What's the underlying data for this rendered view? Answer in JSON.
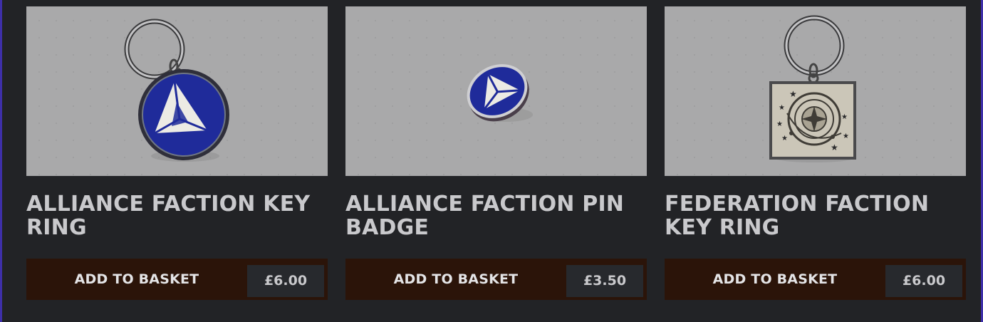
{
  "products": [
    {
      "title": "ALLIANCE FACTION KEY RING",
      "button_label": "ADD TO BASKET",
      "price": "£6.00",
      "image": "alliance-key-ring-photo"
    },
    {
      "title": "ALLIANCE FACTION PIN BADGE",
      "button_label": "ADD TO BASKET",
      "price": "£3.50",
      "image": "alliance-pin-badge-photo"
    },
    {
      "title": "FEDERATION FACTION KEY RING",
      "button_label": "ADD TO BASKET",
      "price": "£6.00",
      "image": "federation-key-ring-photo"
    }
  ],
  "colors": {
    "page_background": "#222326",
    "image_background": "#a9a9aa",
    "title_text": "#c9c9cc",
    "button_background": "#2b1409",
    "price_background": "#27292d",
    "alliance_blue": "#1f2b9a",
    "federation_silver": "#cbc6b8"
  }
}
